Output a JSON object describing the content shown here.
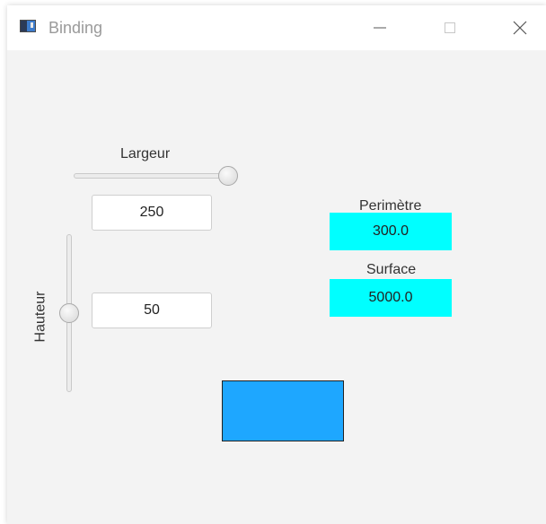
{
  "window": {
    "title": "Binding"
  },
  "controls": {
    "width_label": "Largeur",
    "width_value": "250",
    "width_slider_fraction": 0.98,
    "height_label": "Hauteur",
    "height_value": "50",
    "height_slider_fraction": 0.5
  },
  "results": {
    "perimeter_label": "Perimètre",
    "perimeter_value": "300.0",
    "surface_label": "Surface",
    "surface_value": "5000.0"
  },
  "colors": {
    "window_bg": "#f3f3f3",
    "value_box": "#00ffff",
    "rectangle_fill": "#1ea7ff"
  },
  "icons": [
    "app-icon",
    "minimize-icon",
    "maximize-icon",
    "close-icon"
  ]
}
